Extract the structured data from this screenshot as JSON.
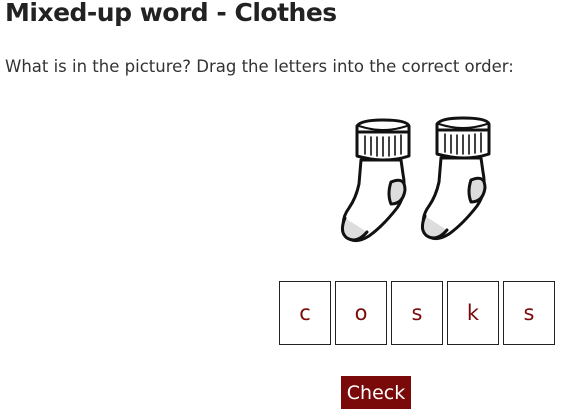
{
  "title": "Mixed-up word - Clothes",
  "instruction": "What is in the picture? Drag the letters into the correct order:",
  "picture": {
    "icon": "socks-icon"
  },
  "letters": [
    "c",
    "o",
    "s",
    "k",
    "s"
  ],
  "check_label": "Check",
  "colors": {
    "accent": "#7a0a0a",
    "text": "#222222",
    "tile_border": "#222222"
  }
}
